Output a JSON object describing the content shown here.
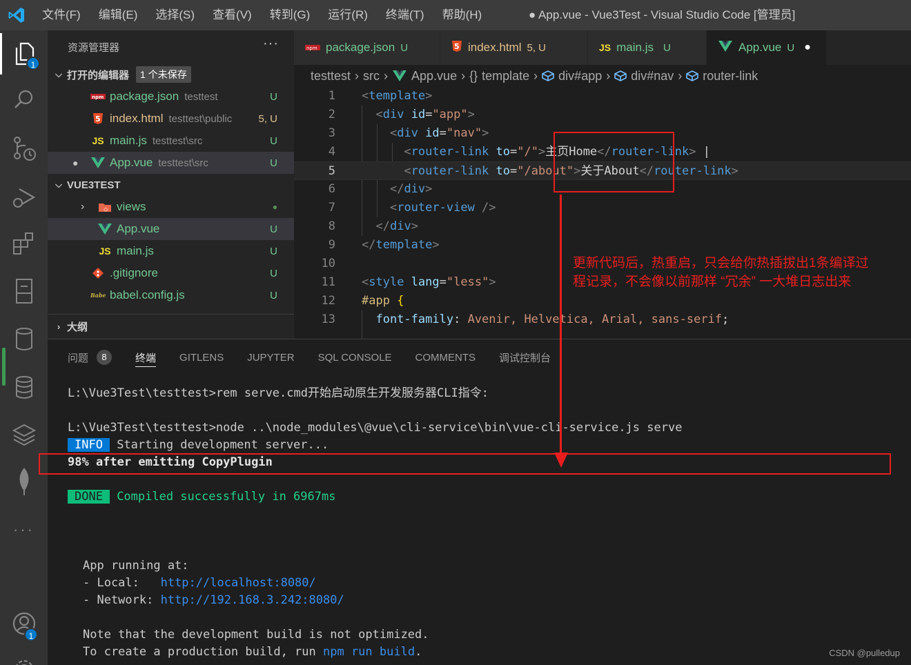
{
  "titlebar": {
    "menu": [
      "文件(F)",
      "编辑(E)",
      "选择(S)",
      "查看(V)",
      "转到(G)",
      "运行(R)",
      "终端(T)",
      "帮助(H)"
    ],
    "title": "● App.vue - Vue3Test - Visual Studio Code [管理员]"
  },
  "activity": {
    "explorer_badge": "1",
    "account_badge": "1"
  },
  "sidebar": {
    "header": "资源管理器",
    "more": "···",
    "open_editors": {
      "title": "打开的编辑器",
      "unsaved": "1 个未保存",
      "items": [
        {
          "icon": "npm",
          "name": "package.json",
          "path": "testtest",
          "status": "U"
        },
        {
          "icon": "5",
          "name": "index.html",
          "path": "testtest\\public",
          "status": "5, U"
        },
        {
          "icon": "JS",
          "name": "main.js",
          "path": "testtest\\src",
          "status": "U"
        },
        {
          "icon": "V",
          "name": "App.vue",
          "path": "testtest\\src",
          "status": "U"
        }
      ]
    },
    "project": {
      "title": "VUE3TEST",
      "items": [
        {
          "name": "views",
          "status": "●"
        },
        {
          "name": "App.vue",
          "status": "U"
        },
        {
          "name": "main.js",
          "status": "U"
        },
        {
          "name": ".gitignore",
          "status": "U"
        },
        {
          "name": "babel.config.js",
          "status": "U"
        }
      ]
    },
    "outline": "大纲"
  },
  "tabs": [
    {
      "name": "package.json",
      "status": "U"
    },
    {
      "name": "index.html",
      "status": "5, U"
    },
    {
      "name": "main.js",
      "status": "U"
    },
    {
      "name": "App.vue",
      "status": "U"
    }
  ],
  "breadcrumb": [
    "testtest",
    "src",
    "App.vue",
    "template",
    "div#app",
    "div#nav",
    "router-link"
  ],
  "editor": {
    "line_numbers": [
      "1",
      "2",
      "3",
      "4",
      "5",
      "6",
      "7",
      "8",
      "9",
      "10",
      "11",
      "12",
      "13"
    ]
  },
  "panel": {
    "tabs": [
      "问题",
      "终端",
      "GITLENS",
      "JUPYTER",
      "SQL CONSOLE",
      "COMMENTS",
      "调试控制台"
    ],
    "problems_count": "8",
    "terminal": {
      "line1": "L:\\Vue3Test\\testtest>rem serve.cmd开始启动原生开发服务器CLI指令:",
      "line2": "L:\\Vue3Test\\testtest>node ..\\node_modules\\@vue\\cli-service\\bin\\vue-cli-service.js serve",
      "info_tag": "INFO",
      "info_text": " Starting development server...",
      "progress": "98% after emitting CopyPlugin",
      "done_tag": "DONE",
      "done_text": " Compiled successfully in 6967ms",
      "running": "App running at:",
      "local_label": "- Local:   ",
      "local_url": "http://localhost:8080/",
      "network_label": "- Network: ",
      "network_url": "http://192.168.3.242:8080/",
      "note1": "Note that the development build is not optimized.",
      "note2_pre": "To create a production build, run ",
      "note2_cmd": "npm run build",
      "note2_post": "."
    }
  },
  "annotation": {
    "text_line1": "更新代码后，热重启，只会给你热插拔出1条编译过",
    "text_line2": "程记录，不会像以前那样 “冗余” 一大堆日志出来"
  },
  "watermark": "CSDN @pulledup",
  "colors": {
    "accent": "#007acc",
    "annotation": "#e81e1e"
  }
}
